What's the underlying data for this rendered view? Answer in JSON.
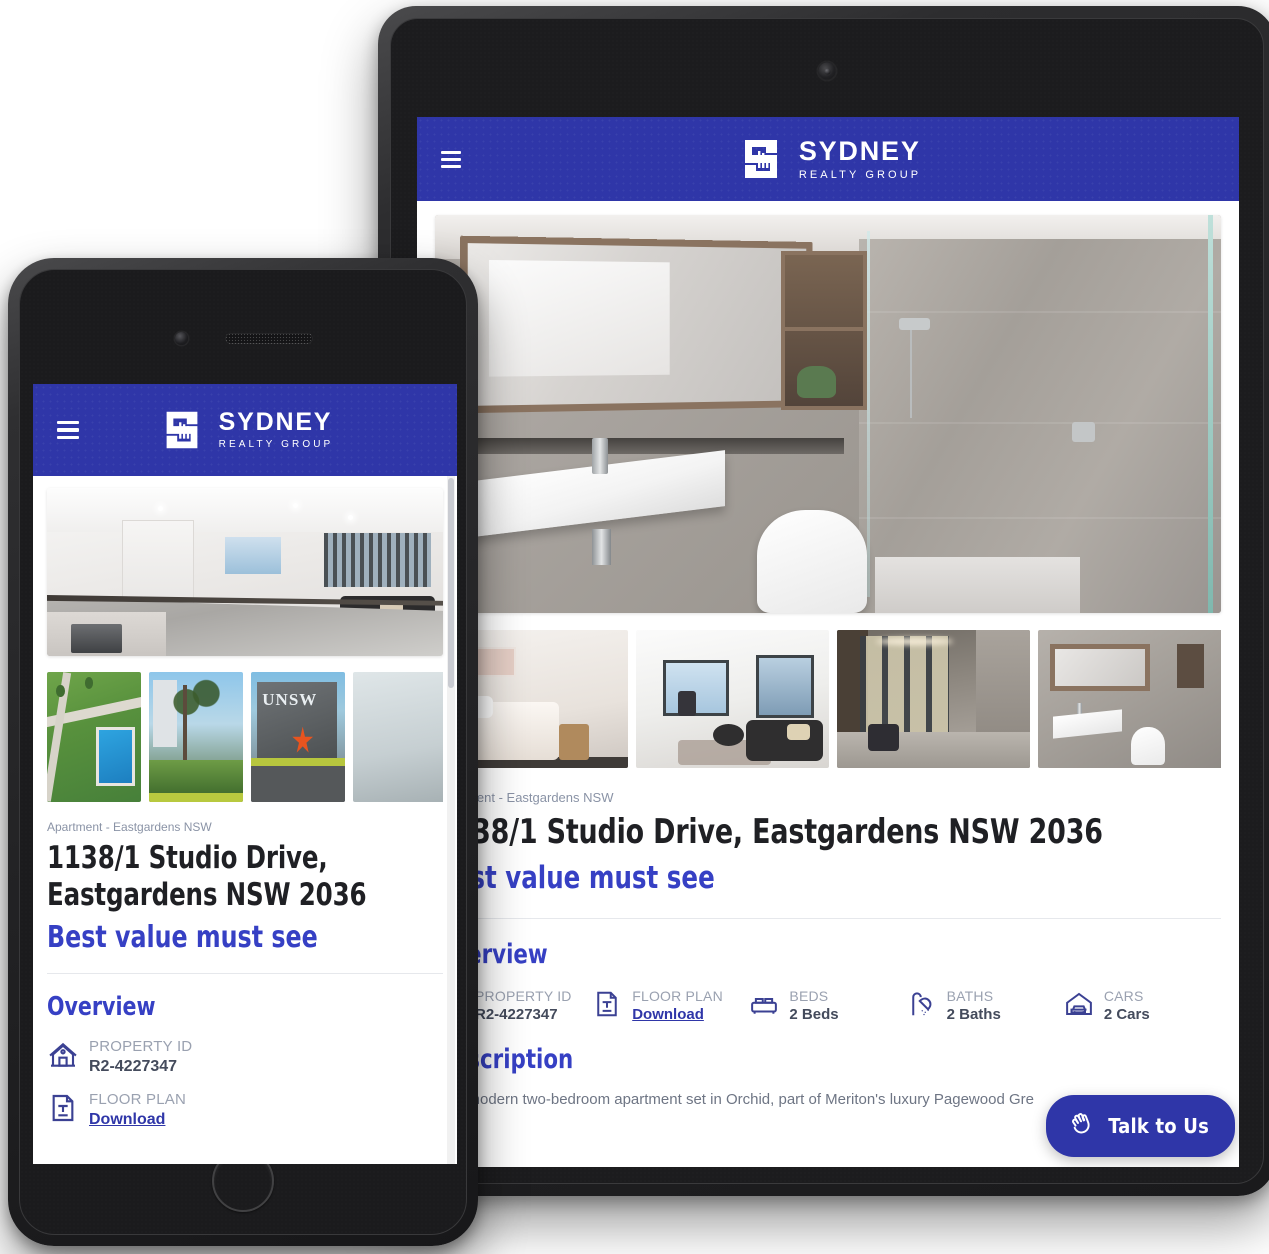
{
  "header": {
    "menu_icon": "hamburger-menu-icon",
    "logo_mark": "sydney-realty-logo-mark",
    "brand_name": "SYDNEY",
    "brand_subtitle": "REALTY GROUP",
    "brand_color": "#2f36a8"
  },
  "gallery": {
    "hero_tablet_alt": "Modern grey-tiled bathroom with mirror, wall-hung basin, toilet and glass shower",
    "hero_phone_alt": "White modern kitchen with stone benchtop looking through to living area",
    "thumbnails_tablet": [
      {
        "alt": "Bedroom with queen bed and bedside table"
      },
      {
        "alt": "Living room with floor-to-ceiling windows and dark sofa"
      },
      {
        "alt": "Building lobby entrance with feature lighting"
      },
      {
        "alt": "Bathroom with mirror, basin and toilet"
      }
    ],
    "thumbnails_phone": [
      {
        "alt": "Aerial view of park and swimming pool"
      },
      {
        "alt": "Leafy street with trees and garden beds"
      },
      {
        "alt": "UNSW campus signage wall"
      },
      {
        "alt": "Partially visible next image"
      }
    ]
  },
  "listing": {
    "category": "Apartment - Eastgardens NSW",
    "address": "1138/1 Studio Drive,  Eastgardens NSW 2036",
    "address_line_1": "1138/1 Studio Drive,",
    "address_line_2": "Eastgardens NSW 2036",
    "tagline": "Best value must see"
  },
  "overview": {
    "title": "Overview",
    "items": [
      {
        "icon": "house-icon",
        "label": "PROPERTY ID",
        "value": "R2-4227347",
        "is_link": false
      },
      {
        "icon": "floorplan-document-icon",
        "label": "FLOOR PLAN",
        "value": "Download",
        "is_link": true
      },
      {
        "icon": "bed-icon",
        "label": "BEDS",
        "value": "2 Beds"
      },
      {
        "icon": "shower-icon",
        "label": "BATHS",
        "value": "2 Baths"
      },
      {
        "icon": "car-garage-icon",
        "label": "CARS",
        "value": "2 Cars"
      }
    ]
  },
  "description": {
    "title": "Description",
    "body": "This modern two-bedroom apartment set in Orchid, part of Meriton's luxury Pagewood Gre"
  },
  "chat_widget": {
    "label": "Talk to Us",
    "icon": "waving-hand-icon",
    "color": "#2f36a8"
  },
  "colors": {
    "brand_blue": "#2f36a8",
    "heading_blue": "#3640c4",
    "icon_blue": "#3b4193",
    "text_dark": "#1f2024",
    "text_muted": "#8a93a6",
    "value_grey": "#444b5c"
  }
}
